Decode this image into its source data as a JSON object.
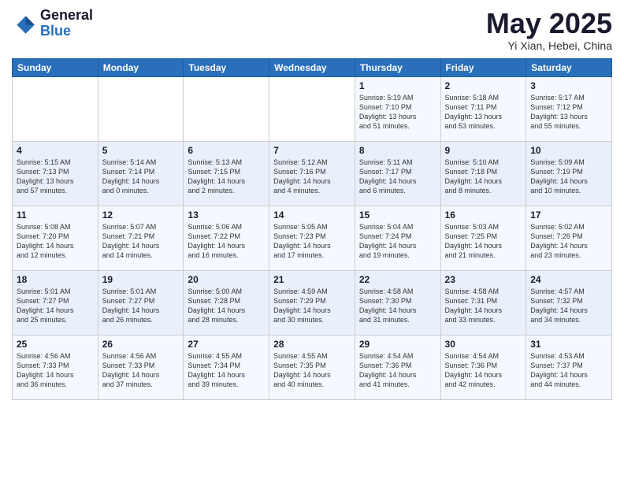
{
  "header": {
    "logo_general": "General",
    "logo_blue": "Blue",
    "month_title": "May 2025",
    "location": "Yi Xian, Hebei, China"
  },
  "weekdays": [
    "Sunday",
    "Monday",
    "Tuesday",
    "Wednesday",
    "Thursday",
    "Friday",
    "Saturday"
  ],
  "weeks": [
    [
      {
        "day": "",
        "info": ""
      },
      {
        "day": "",
        "info": ""
      },
      {
        "day": "",
        "info": ""
      },
      {
        "day": "",
        "info": ""
      },
      {
        "day": "1",
        "info": "Sunrise: 5:19 AM\nSunset: 7:10 PM\nDaylight: 13 hours\nand 51 minutes."
      },
      {
        "day": "2",
        "info": "Sunrise: 5:18 AM\nSunset: 7:11 PM\nDaylight: 13 hours\nand 53 minutes."
      },
      {
        "day": "3",
        "info": "Sunrise: 5:17 AM\nSunset: 7:12 PM\nDaylight: 13 hours\nand 55 minutes."
      }
    ],
    [
      {
        "day": "4",
        "info": "Sunrise: 5:15 AM\nSunset: 7:13 PM\nDaylight: 13 hours\nand 57 minutes."
      },
      {
        "day": "5",
        "info": "Sunrise: 5:14 AM\nSunset: 7:14 PM\nDaylight: 14 hours\nand 0 minutes."
      },
      {
        "day": "6",
        "info": "Sunrise: 5:13 AM\nSunset: 7:15 PM\nDaylight: 14 hours\nand 2 minutes."
      },
      {
        "day": "7",
        "info": "Sunrise: 5:12 AM\nSunset: 7:16 PM\nDaylight: 14 hours\nand 4 minutes."
      },
      {
        "day": "8",
        "info": "Sunrise: 5:11 AM\nSunset: 7:17 PM\nDaylight: 14 hours\nand 6 minutes."
      },
      {
        "day": "9",
        "info": "Sunrise: 5:10 AM\nSunset: 7:18 PM\nDaylight: 14 hours\nand 8 minutes."
      },
      {
        "day": "10",
        "info": "Sunrise: 5:09 AM\nSunset: 7:19 PM\nDaylight: 14 hours\nand 10 minutes."
      }
    ],
    [
      {
        "day": "11",
        "info": "Sunrise: 5:08 AM\nSunset: 7:20 PM\nDaylight: 14 hours\nand 12 minutes."
      },
      {
        "day": "12",
        "info": "Sunrise: 5:07 AM\nSunset: 7:21 PM\nDaylight: 14 hours\nand 14 minutes."
      },
      {
        "day": "13",
        "info": "Sunrise: 5:06 AM\nSunset: 7:22 PM\nDaylight: 14 hours\nand 16 minutes."
      },
      {
        "day": "14",
        "info": "Sunrise: 5:05 AM\nSunset: 7:23 PM\nDaylight: 14 hours\nand 17 minutes."
      },
      {
        "day": "15",
        "info": "Sunrise: 5:04 AM\nSunset: 7:24 PM\nDaylight: 14 hours\nand 19 minutes."
      },
      {
        "day": "16",
        "info": "Sunrise: 5:03 AM\nSunset: 7:25 PM\nDaylight: 14 hours\nand 21 minutes."
      },
      {
        "day": "17",
        "info": "Sunrise: 5:02 AM\nSunset: 7:26 PM\nDaylight: 14 hours\nand 23 minutes."
      }
    ],
    [
      {
        "day": "18",
        "info": "Sunrise: 5:01 AM\nSunset: 7:27 PM\nDaylight: 14 hours\nand 25 minutes."
      },
      {
        "day": "19",
        "info": "Sunrise: 5:01 AM\nSunset: 7:27 PM\nDaylight: 14 hours\nand 26 minutes."
      },
      {
        "day": "20",
        "info": "Sunrise: 5:00 AM\nSunset: 7:28 PM\nDaylight: 14 hours\nand 28 minutes."
      },
      {
        "day": "21",
        "info": "Sunrise: 4:59 AM\nSunset: 7:29 PM\nDaylight: 14 hours\nand 30 minutes."
      },
      {
        "day": "22",
        "info": "Sunrise: 4:58 AM\nSunset: 7:30 PM\nDaylight: 14 hours\nand 31 minutes."
      },
      {
        "day": "23",
        "info": "Sunrise: 4:58 AM\nSunset: 7:31 PM\nDaylight: 14 hours\nand 33 minutes."
      },
      {
        "day": "24",
        "info": "Sunrise: 4:57 AM\nSunset: 7:32 PM\nDaylight: 14 hours\nand 34 minutes."
      }
    ],
    [
      {
        "day": "25",
        "info": "Sunrise: 4:56 AM\nSunset: 7:33 PM\nDaylight: 14 hours\nand 36 minutes."
      },
      {
        "day": "26",
        "info": "Sunrise: 4:56 AM\nSunset: 7:33 PM\nDaylight: 14 hours\nand 37 minutes."
      },
      {
        "day": "27",
        "info": "Sunrise: 4:55 AM\nSunset: 7:34 PM\nDaylight: 14 hours\nand 39 minutes."
      },
      {
        "day": "28",
        "info": "Sunrise: 4:55 AM\nSunset: 7:35 PM\nDaylight: 14 hours\nand 40 minutes."
      },
      {
        "day": "29",
        "info": "Sunrise: 4:54 AM\nSunset: 7:36 PM\nDaylight: 14 hours\nand 41 minutes."
      },
      {
        "day": "30",
        "info": "Sunrise: 4:54 AM\nSunset: 7:36 PM\nDaylight: 14 hours\nand 42 minutes."
      },
      {
        "day": "31",
        "info": "Sunrise: 4:53 AM\nSunset: 7:37 PM\nDaylight: 14 hours\nand 44 minutes."
      }
    ]
  ]
}
